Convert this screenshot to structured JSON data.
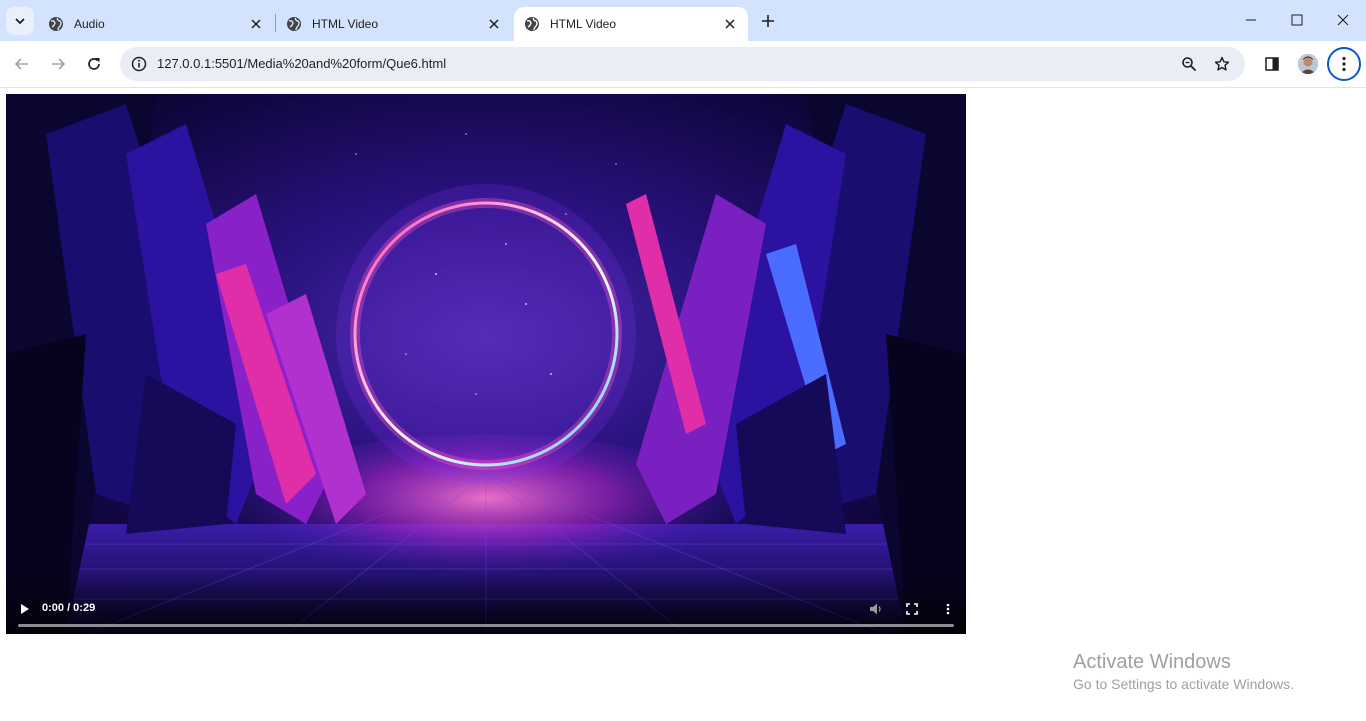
{
  "tabs": [
    {
      "title": "Audio",
      "active": false
    },
    {
      "title": "HTML Video",
      "active": false
    },
    {
      "title": "HTML Video",
      "active": true
    }
  ],
  "icons": {
    "tab_search": "chevron-down-icon",
    "tab_favicon": "globe-icon",
    "tab_close": "close-icon",
    "new_tab": "plus-icon",
    "minimize": "minimize-icon",
    "maximize": "maximize-icon",
    "close_window": "close-icon",
    "back": "arrow-left-icon",
    "forward": "arrow-right-icon",
    "reload": "reload-icon",
    "site_info": "info-icon",
    "zoom": "zoom-icon",
    "bookmark": "star-icon",
    "side_panel": "side-panel-icon",
    "menu": "kebab-menu-icon"
  },
  "address_bar": {
    "url": "127.0.0.1:5501/Media%20and%20form/Que6.html"
  },
  "video": {
    "time_display": "0:00 / 0:29",
    "progress": 0.0
  },
  "watermark": {
    "line1": "Activate Windows",
    "line2": "Go to Settings to activate Windows."
  },
  "colors": {
    "tabstrip_bg": "#d3e3fd",
    "omnibox_bg": "#e9eef6",
    "focus_ring": "#0b57d0"
  }
}
